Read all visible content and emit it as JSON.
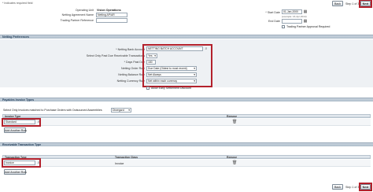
{
  "header": {
    "required_note": "* Indicates required field",
    "back_label": "Back",
    "step_text": "Step 1 of 3",
    "next_label": "Next"
  },
  "top_fields": {
    "operating_unit_label": "Operating Unit",
    "operating_unit_value": "Vision Operations",
    "netting_agreement_label": "Netting Agreement Name",
    "netting_agreement_value": "Netting AP/AR",
    "trading_partner_label": "Trading Partner Reference",
    "start_date_label": "* Start Date",
    "start_date_value": "01-Jan-2000",
    "start_date_example": "(example: 16-Apr-2014)",
    "end_date_label": "End Date",
    "trading_partner_approval_label": "Trading Partner Approval Required"
  },
  "netting_preferences": {
    "title": "Netting Preferences",
    "bank_account_label": "* Netting Bank Account",
    "bank_account_value": "NETTING BATCH ACCOUNT",
    "past_due_label": "Select Only Past Due Receivable Transactions",
    "past_due_value": "Yes",
    "days_past_due_label": "* Days Past Due",
    "days_past_due_value": "180",
    "order_rule_label": "Netting Order Rule",
    "order_rule_value": "Due Date (Oldest to most recent)",
    "balance_rule_label": "Netting Balance Rule",
    "balance_rule_value": "Net Always",
    "currency_rule_label": "Netting Currency Rule",
    "currency_rule_value": "Net within each currency",
    "allow_early_label": "Allow Early Settlement Discount"
  },
  "payables": {
    "title": "Payables Invoice Types",
    "select_invoices_label": "Select Only Invoices matched to Purchase Orders with Outsourced Assemblies",
    "select_invoices_value": "Disregard",
    "col_type": "Invoice Type",
    "col_remove": "Remove",
    "row_value": "Standard",
    "add_row_label": "Add Another Row"
  },
  "receivables": {
    "title": "Receivable Transaction Type",
    "col_type": "Transaction Type",
    "col_class": "Transaction Class",
    "col_remove": "Remove",
    "row_value": "Invoice",
    "row_class": "Invoice",
    "add_row_label": "Add Another Row"
  },
  "footer": {
    "back_label": "Back",
    "step_text": "Step 1 of 3",
    "next_label": "Next"
  },
  "icons": {
    "search": "search-icon",
    "remove": "trash-icon",
    "dropdown": "chevron-down-icon",
    "calendar": "calendar-icon"
  }
}
